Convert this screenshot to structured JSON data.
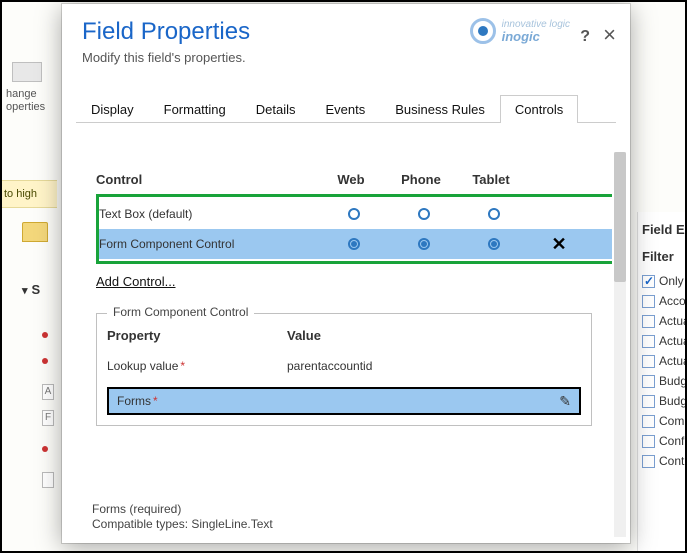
{
  "dialog": {
    "title": "Field Properties",
    "subtitle": "Modify this field's properties.",
    "logo": {
      "top": "innovative logic",
      "name": "inogic"
    },
    "help": "?",
    "close": "×"
  },
  "tabs": {
    "items": [
      "Display",
      "Formatting",
      "Details",
      "Events",
      "Business Rules",
      "Controls"
    ],
    "active": 5
  },
  "controls_table": {
    "headers": {
      "control": "Control",
      "web": "Web",
      "phone": "Phone",
      "tablet": "Tablet"
    },
    "rows": [
      {
        "label": "Text Box (default)",
        "web": false,
        "phone": false,
        "tablet": false,
        "removable": false,
        "selected": false
      },
      {
        "label": "Form Component Control",
        "web": true,
        "phone": true,
        "tablet": true,
        "removable": true,
        "selected": true
      }
    ],
    "add_link": "Add Control...",
    "remove_glyph": "✕"
  },
  "fcc": {
    "legend": "Form Component Control",
    "col_property": "Property",
    "col_value": "Value",
    "lookup": {
      "label": "Lookup value",
      "value": "parentaccountid"
    },
    "forms": {
      "label": "Forms",
      "edit_glyph": "✎"
    },
    "footnote1": "Forms (required)",
    "footnote2": "Compatible types: SingleLine.Text"
  },
  "background": {
    "ribbon_label1": "hange",
    "ribbon_label2": "operties",
    "band_text": "to high",
    "section_label": "S",
    "box_label": "A",
    "box_label2": "F"
  },
  "right_panel": {
    "title": "Field Ex",
    "filter_label": "Filter",
    "only": {
      "checked": true,
      "label": "Only"
    },
    "items": [
      "Accou",
      "Actua",
      "Actua",
      "Actua",
      "Budge",
      "Budge",
      "Comp",
      "Confi",
      "Contr"
    ]
  }
}
